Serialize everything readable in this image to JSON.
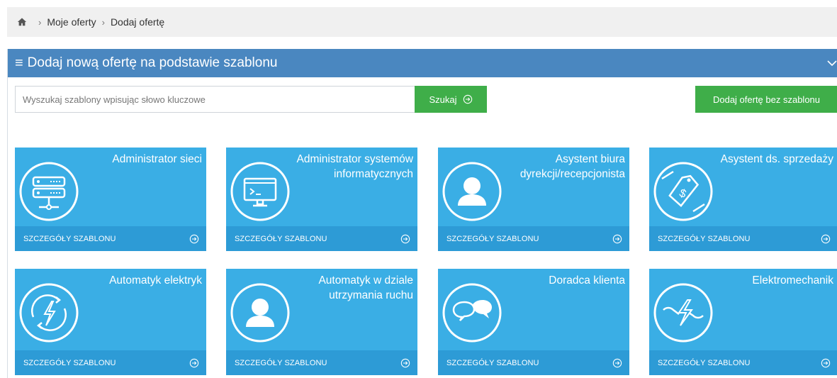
{
  "breadcrumb": {
    "items": [
      "Moje oferty",
      "Dodaj ofertę"
    ]
  },
  "panel": {
    "title": "Dodaj nową ofertę na podstawie szablonu"
  },
  "search": {
    "placeholder": "Wyszukaj szablony wpisując słowo kluczowe",
    "button_label": "Szukaj",
    "add_without_template_label": "Dodaj ofertę bez szablonu"
  },
  "templates": [
    {
      "title": "Administrator sieci",
      "footer": "SZCZEGÓŁY SZABLONU",
      "icon": "server-icon"
    },
    {
      "title": "Administrator systemów informatycznych",
      "footer": "SZCZEGÓŁY SZABLONU",
      "icon": "monitor-terminal-icon"
    },
    {
      "title": "Asystent biura dyrekcji/recepcjonista",
      "footer": "SZCZEGÓŁY SZABLONU",
      "icon": "user-icon"
    },
    {
      "title": "Asystent ds. sprzedaży",
      "footer": "SZCZEGÓŁY SZABLONU",
      "icon": "price-tag-icon"
    },
    {
      "title": "Automatyk elektryk",
      "footer": "SZCZEGÓŁY SZABLONU",
      "icon": "lightning-cycle-icon"
    },
    {
      "title": "Automatyk w dziale utrzymania ruchu",
      "footer": "SZCZEGÓŁY SZABLONU",
      "icon": "user-icon"
    },
    {
      "title": "Doradca klienta",
      "footer": "SZCZEGÓŁY SZABLONU",
      "icon": "chat-bubbles-icon"
    },
    {
      "title": "Elektromechanik",
      "footer": "SZCZEGÓŁY SZABLONU",
      "icon": "wrench-lightning-icon"
    }
  ],
  "colors": {
    "header_blue": "#4a87c0",
    "tile_blue": "#3aaee5",
    "tile_footer_blue": "#2d9bd6",
    "button_green": "#3fae49"
  }
}
